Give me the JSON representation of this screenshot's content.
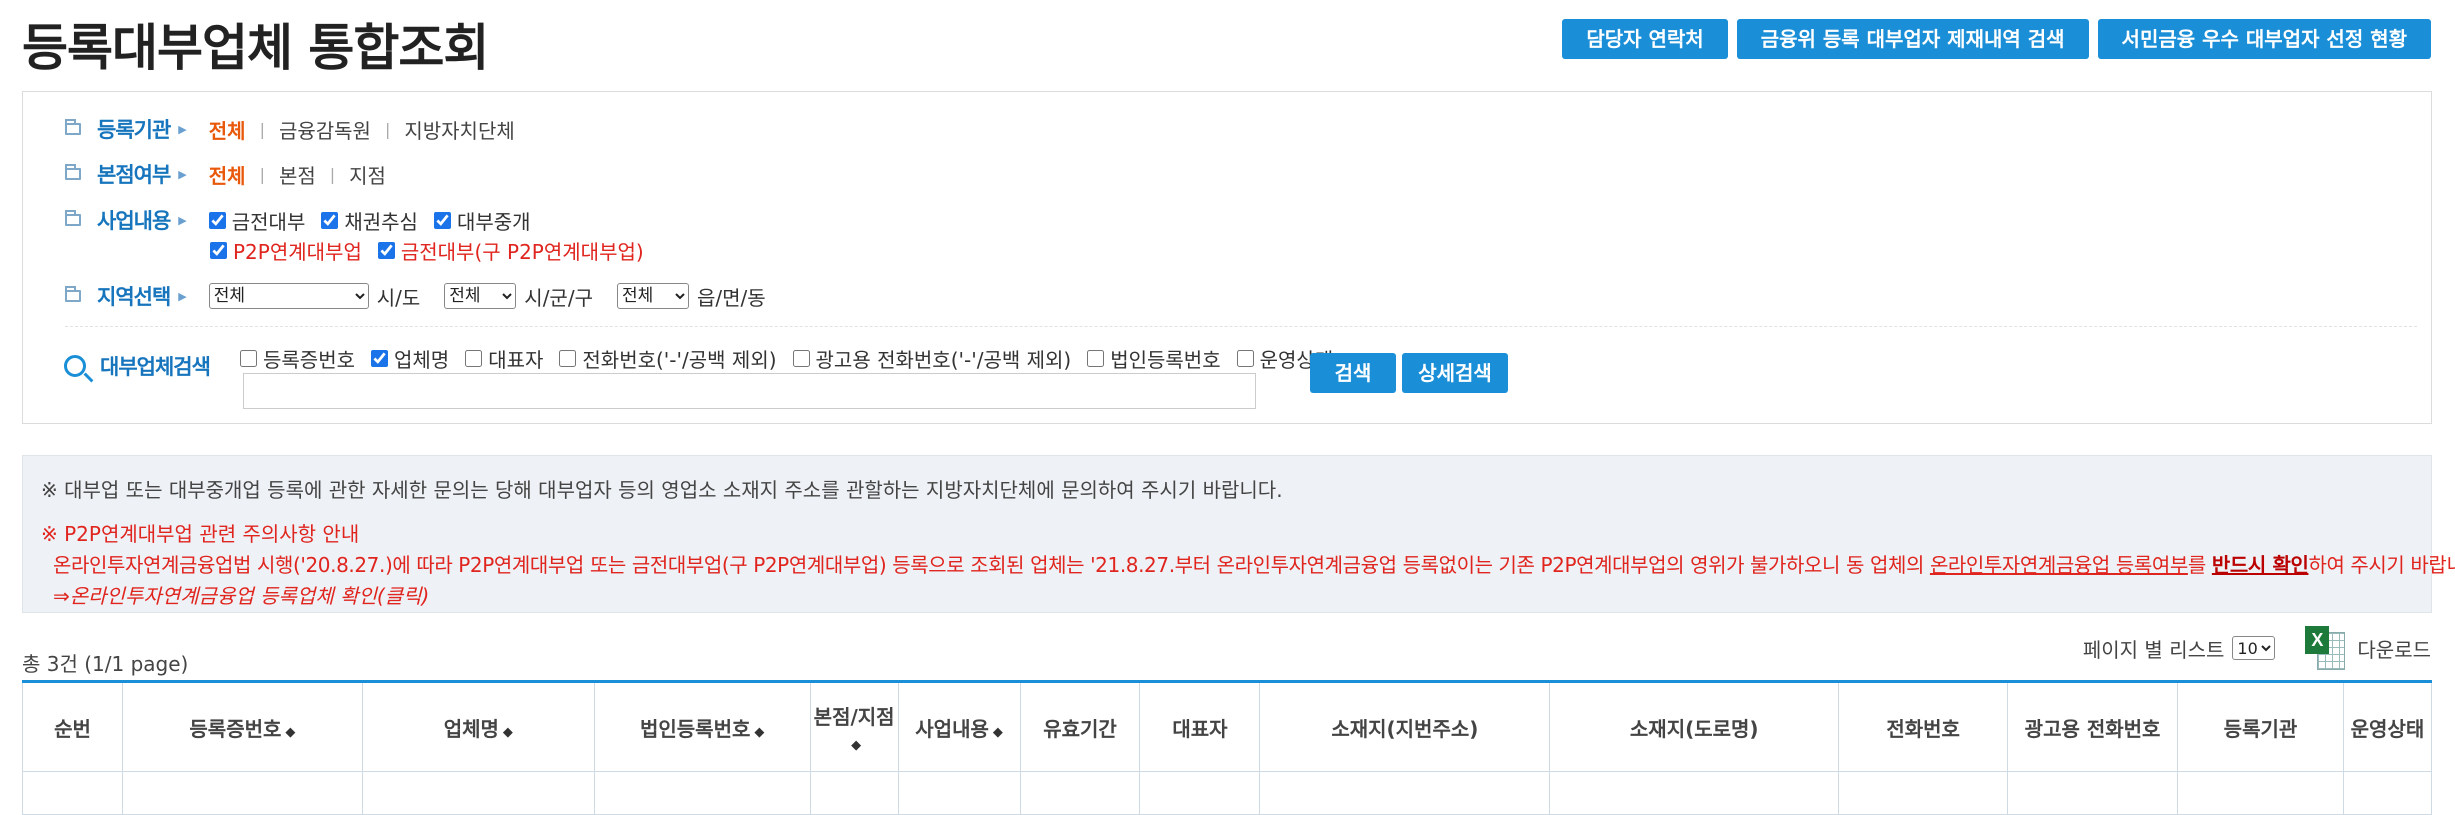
{
  "title": "등록대부업체 통합조회",
  "top_buttons": [
    "담당자 연락처",
    "금융위 등록 대부업자 제재내역 검색",
    "서민금융 우수 대부업자 선정 현황"
  ],
  "filters": {
    "reg_org": {
      "label": "등록기관",
      "options": [
        "전체",
        "금융감독원",
        "지방자치단체"
      ],
      "selected": "전체"
    },
    "branch": {
      "label": "본점여부",
      "options": [
        "전체",
        "본점",
        "지점"
      ],
      "selected": "전체"
    },
    "business": {
      "label": "사업내용",
      "checks": [
        {
          "text": "금전대부",
          "checked": true
        },
        {
          "text": "채권추심",
          "checked": true
        },
        {
          "text": "대부중개",
          "checked": true
        },
        {
          "text": "P2P연계대부업",
          "checked": true
        },
        {
          "text": "금전대부(구 P2P연계대부업)",
          "checked": true
        }
      ]
    },
    "region": {
      "label": "지역선택",
      "sido_value": "전체",
      "sido_unit": "시/도",
      "sigungu_value": "전체",
      "sigungu_unit": "시/군/구",
      "dong_value": "전체",
      "dong_unit": "읍/면/동"
    }
  },
  "search": {
    "label": "대부업체검색",
    "checks": [
      {
        "text": "등록증번호",
        "checked": false
      },
      {
        "text": "업체명",
        "checked": true
      },
      {
        "text": "대표자",
        "checked": false
      },
      {
        "text": "전화번호('-'/공백 제외)",
        "checked": false
      },
      {
        "text": "광고용 전화번호('-'/공백 제외)",
        "checked": false
      },
      {
        "text": "법인등록번호",
        "checked": false
      },
      {
        "text": "운영상태",
        "checked": false
      }
    ],
    "input_value": "",
    "search_btn": "검색",
    "detail_btn": "상세검색"
  },
  "notice": {
    "line1": "※ 대부업 또는 대부중개업 등록에 관한 자세한 문의는 당해 대부업자 등의 영업소 소재지 주소를 관할하는 지방자치단체에 문의하여 주시기 바랍니다.",
    "line2": "※ P2P연계대부업 관련 주의사항 안내",
    "line3a": "온라인투자연계금융업법 시행('20.8.27.)에 따라 P2P연계대부업 또는 금전대부업(구 P2P연계대부업) 등록으로 조회된 업체는 '21.8.27.부터 온라인투자연계금융업 등록없이는 기존 P2P연계대부업의 영위가 불가하오니 동 업체의 ",
    "line3b": "온라인투자연계금융업 등록여부",
    "line3c": "를 ",
    "line3d": "반드시 확인",
    "line3e": "하여 주시기 바랍니다.",
    "line4": "⇒온라인투자연계금융업 등록업체 확인(클릭)"
  },
  "list": {
    "total": "총 3건 (1/1 page)",
    "per_page_label": "페이지 별 리스트",
    "per_page_value": "10",
    "download": "다운로드",
    "columns": [
      {
        "label": "순번",
        "sort": false
      },
      {
        "label": "등록증번호",
        "sort": true
      },
      {
        "label": "업체명",
        "sort": true
      },
      {
        "label": "법인등록번호",
        "sort": true
      },
      {
        "label": "본점/지점",
        "sort": true
      },
      {
        "label": "사업내용",
        "sort": true
      },
      {
        "label": "유효기간",
        "sort": false
      },
      {
        "label": "대표자",
        "sort": false
      },
      {
        "label": "소재지(지번주소)",
        "sort": false
      },
      {
        "label": "소재지(도로명)",
        "sort": false
      },
      {
        "label": "전화번호",
        "sort": false
      },
      {
        "label": "광고용 전화번호",
        "sort": false
      },
      {
        "label": "등록기관",
        "sort": false
      },
      {
        "label": "운영상태",
        "sort": false
      }
    ]
  }
}
